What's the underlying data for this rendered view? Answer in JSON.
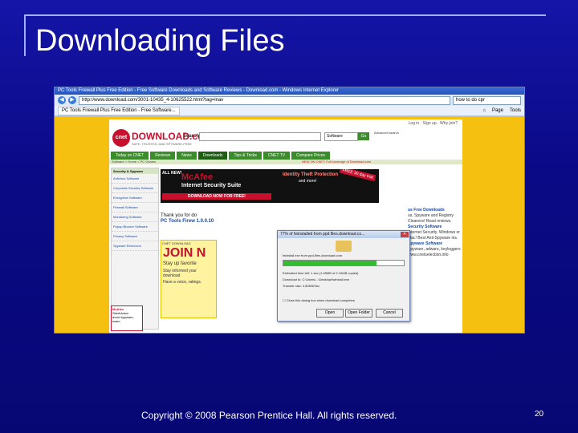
{
  "slide": {
    "title": "Downloading Files",
    "footer": "Copyright © 2008 Pearson Prentice Hall. All rights reserved.",
    "page_number": "20"
  },
  "browser": {
    "window_title": "PC Tools Firewall Plus Free Edition - Free Software Downloads and Software Reviews - Download.com - Windows Internet Explorer",
    "address": "http://www.download.com/3001-10435_4-10625522.html?tag=lnav",
    "search_value": "how to do cpr",
    "tab_label": "PC Tools Firewall Plus Free Edition - Free Software...",
    "page_menu": "Page",
    "tools_menu": "Tools"
  },
  "site": {
    "top_links": "Log in · Sign up · Why join?",
    "logo_mark": "cnet",
    "logo": "DOWNLOAD.com",
    "tagline": "SAFE, TRUSTED, AND SPYWARE-FREE",
    "search_label": "Search:",
    "search_scope": "Software",
    "go_label": "Go",
    "advanced_link": "Advanced search",
    "nav": [
      "Today on CNET",
      "Reviews",
      "News",
      "Downloads",
      "Tips & Tricks",
      "CNET TV",
      "Compare Prices"
    ],
    "breadcrumb": "Software > Home > PC Games",
    "news_link": "NEW ON CNET: Full coverage of Download.com"
  },
  "sidebar": {
    "heading": "Security & Spyware",
    "items": [
      "Antivirus Software",
      "Corporate Security Software",
      "Encryption Software",
      "Firewall Software",
      "Monitoring Software",
      "Popup Blocker Software",
      "Privacy Software",
      "Spyware Removers"
    ],
    "ad_brand": "McAfee",
    "ad_product": "SiteAdvisor",
    "ad_text": "avoid spyware, scam"
  },
  "ad": {
    "new_label": "ALL NEW!",
    "brand": "McAfee",
    "product": "Internet Security Suite",
    "cta": "DOWNLOAD NOW FOR FREE!",
    "headline": "Identity Theft Protection",
    "more": "and more!",
    "badge": "FREE 30 day trial"
  },
  "main": {
    "thanks": "Thank you for do",
    "product": "PC Tools Firew 1.0.0.10",
    "promo_head": "CNET DOWNLOAD",
    "promo_join": "JOIN N",
    "promo_stay": "Stay up favorite",
    "promo_info": "Stay informed your download",
    "promo_voice": "Have a voice, ratings."
  },
  "right_list": [
    {
      "title": "us Free Downloads",
      "text": "us, Spyware and Registry Cleaners! Read reviews."
    },
    {
      "title": "Security Software",
      "text": "Internet Security. Windows or Mac! Best Anti-Spyware nis."
    },
    {
      "title": "Spyware Software",
      "text": "Spyware, adware, keyloggers www.cnetselection.info"
    }
  ],
  "dialog": {
    "title": "77% of fwinstalled from ppd files.download.co...",
    "source": "fwinstall.exe from ppd-files.download.com",
    "progress": 0.77,
    "time_left": "Estimated time left: 1 sec (1.65MB of 2.10MB copied)",
    "download_to": "Download to: C:\\Users\\...\\Desktop\\fwinstall.exe",
    "transfer_rate": "Transfer rate: 3.80KB/Sec",
    "close_option": "Close this dialog box when download completes",
    "buttons": [
      "Open",
      "Open Folder",
      "Cancel"
    ]
  }
}
